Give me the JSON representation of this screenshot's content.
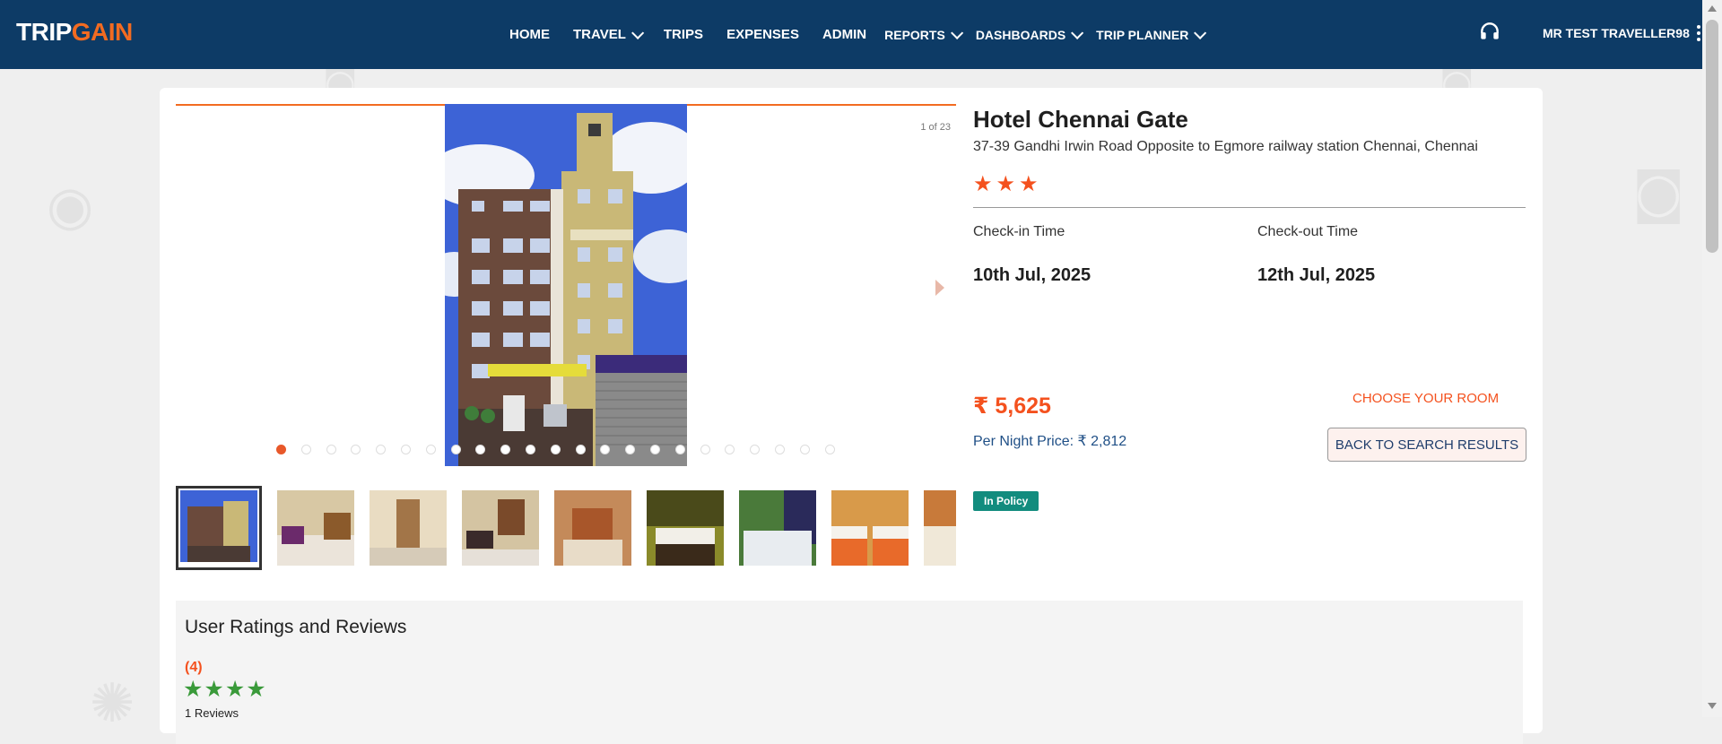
{
  "brand": {
    "logo_trip": "TRIP",
    "logo_gain": "GAIN"
  },
  "nav": {
    "items": [
      {
        "label": "HOME",
        "dropdown": false
      },
      {
        "label": "TRAVEL",
        "dropdown": true
      },
      {
        "label": "TRIPS",
        "dropdown": false
      },
      {
        "label": "EXPENSES",
        "dropdown": false
      },
      {
        "label": "ADMIN",
        "dropdown": false
      },
      {
        "label": "REPORTS",
        "dropdown": true
      },
      {
        "label": "DASHBOARDS",
        "dropdown": true
      },
      {
        "label": "TRIP PLANNER",
        "dropdown": true
      }
    ],
    "user_name": "MR TEST TRAVELLER98",
    "support_icon": "headset-icon",
    "menu_icon": "kebab-menu-icon"
  },
  "gallery": {
    "counter": "1 of 23",
    "total_images": 23,
    "active_index": 0,
    "thumbnails": [
      "hotel-exterior",
      "lobby",
      "corridor",
      "reception",
      "reception-desk",
      "bedroom-dark",
      "bedroom-green",
      "bedroom-twin-orange",
      "bedroom-partial"
    ]
  },
  "hotel": {
    "name": "Hotel Chennai Gate",
    "address": "37-39 Gandhi Irwin Road Opposite to Egmore railway station Chennai, Chennai",
    "star_rating": 3,
    "checkin_label": "Check-in Time",
    "checkin_value": "10th Jul, 2025",
    "checkout_label": "Check-out Time",
    "checkout_value": "12th Jul, 2025",
    "price": "₹ 5,625",
    "per_night": "Per Night Price: ₹ 2,812",
    "choose_room": "CHOOSE YOUR ROOM",
    "back_button": "BACK TO SEARCH RESULTS",
    "policy_badge": "In Policy"
  },
  "reviews": {
    "title": "User Ratings and Reviews",
    "score": "(4)",
    "stars": 4,
    "count": "1 Reviews"
  },
  "colors": {
    "nav_bg": "#0d3b66",
    "accent": "#f4511e",
    "policy_badge": "#128c7e",
    "review_star": "#3a9a3a"
  }
}
